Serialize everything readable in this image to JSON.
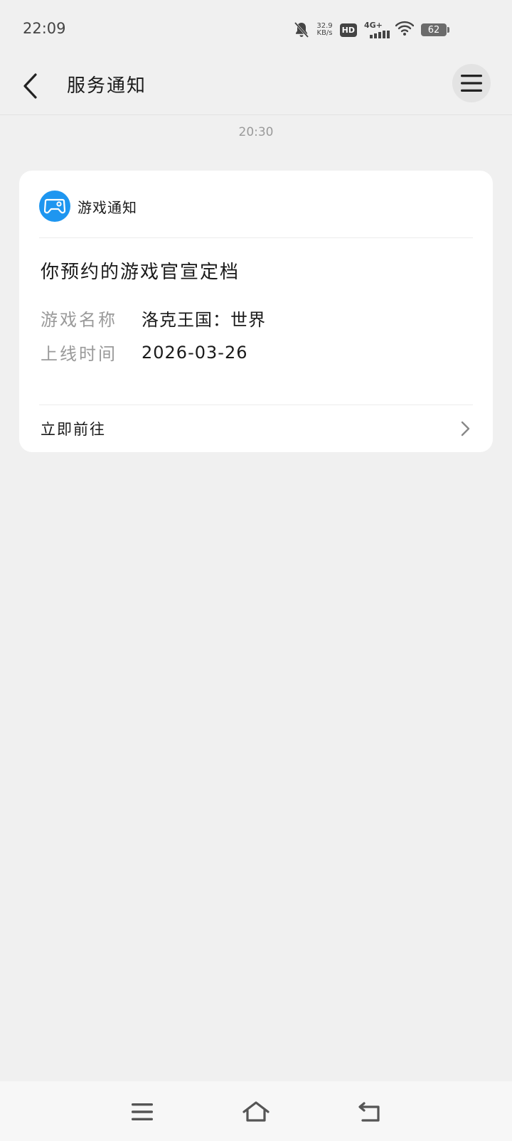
{
  "status_bar": {
    "time": "22:09",
    "net_speed_value": "32.9",
    "net_speed_unit": "KB/s",
    "hd_badge": "HD",
    "network_type": "4G+",
    "battery_level": "62"
  },
  "header": {
    "title": "服务通知",
    "back_icon": "chevron-left-icon",
    "menu_icon": "hamburger-menu-icon"
  },
  "message": {
    "timestamp": "20:30",
    "card": {
      "source_icon": "gamepad-icon",
      "source_name": "游戏通知",
      "title": "你预约的游戏官宣定档",
      "fields": [
        {
          "label": "游戏名称",
          "value": "洛克王国：世界"
        },
        {
          "label": "上线时间",
          "value": "2026-03-26"
        }
      ],
      "action_label": "立即前往",
      "action_icon": "chevron-right-icon"
    }
  },
  "nav_bar": {
    "menu_icon": "recent-apps-icon",
    "home_icon": "home-icon",
    "back_icon": "back-icon"
  },
  "colors": {
    "background": "#f0f0f0",
    "card": "#ffffff",
    "accent": "#1e96f0",
    "muted_text": "#9a9a9a"
  }
}
